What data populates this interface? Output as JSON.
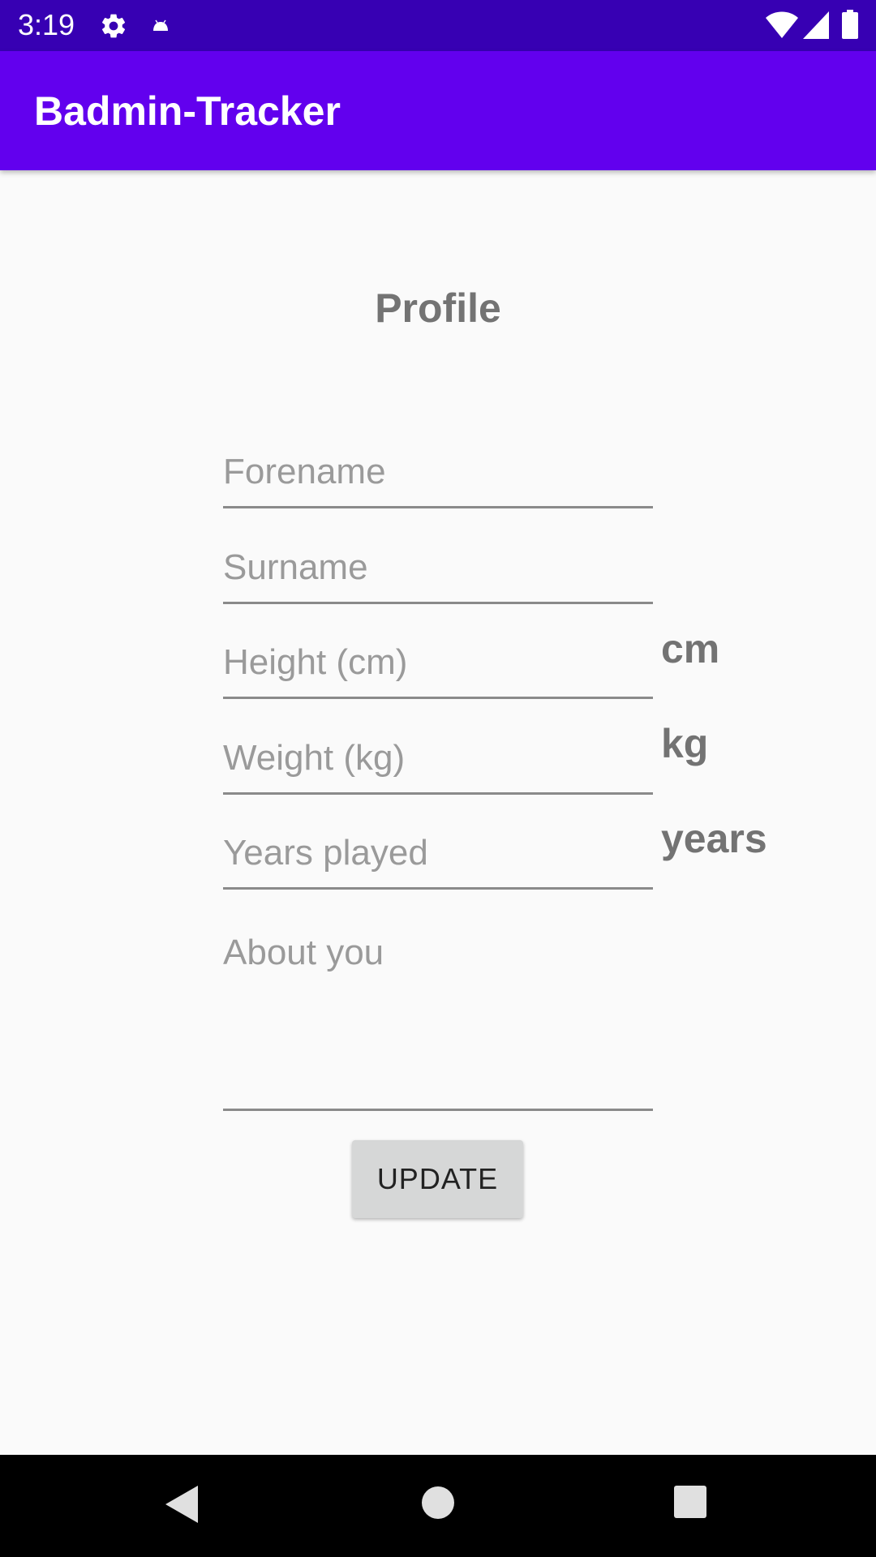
{
  "status_bar": {
    "time": "3:19",
    "icons": [
      "gear-icon",
      "android-icon",
      "wifi-icon",
      "signal-icon",
      "battery-icon"
    ]
  },
  "app_bar": {
    "title": "Badmin-Tracker",
    "color": "#6200ee"
  },
  "profile": {
    "title": "Profile",
    "fields": {
      "forename": {
        "value": "",
        "placeholder": "Forename"
      },
      "surname": {
        "value": "",
        "placeholder": "Surname"
      },
      "height": {
        "value": "",
        "placeholder": "Height (cm)",
        "unit": "cm"
      },
      "weight": {
        "value": "",
        "placeholder": "Weight (kg)",
        "unit": "kg"
      },
      "years_played": {
        "value": "",
        "placeholder": "Years played",
        "unit": "years"
      },
      "about": {
        "value": "",
        "placeholder": "About you"
      }
    },
    "update_label": "UPDATE"
  },
  "nav_bar": {
    "buttons": [
      "back-icon",
      "home-icon",
      "recents-icon"
    ]
  },
  "colors": {
    "status_bar": "#3700b3",
    "app_bar": "#6200ee",
    "background": "#fafafa",
    "button": "#d6d7d7"
  }
}
